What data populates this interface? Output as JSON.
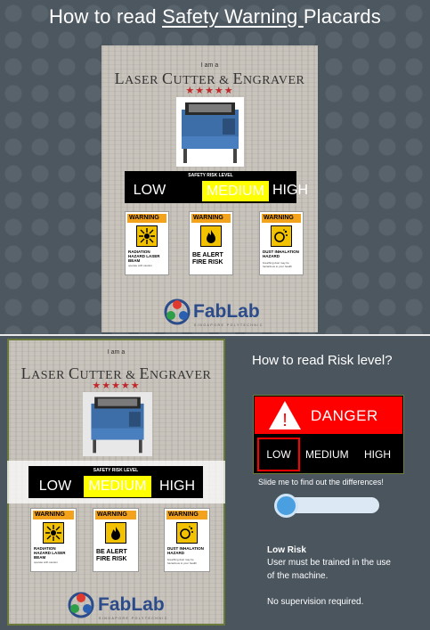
{
  "header": {
    "title_prefix": "How to read ",
    "title_underlined": "Safety Warning ",
    "title_suffix": "Placards"
  },
  "placard": {
    "intro": "I am a",
    "title_a": "L",
    "title_b": "ASER ",
    "title_c": "C",
    "title_d": "UTTER & ",
    "title_e": "E",
    "title_f": "NGRAVER",
    "stars": "★★★★★",
    "risk_caption": "SAFETY RISK LEVEL",
    "risk_low": "LOW",
    "risk_medium": "MEDIUM",
    "risk_high": "HIGH",
    "warnings": [
      {
        "head": "WARNING",
        "text": "RADIATION HAZARD LASER BEAM",
        "small": "operate with caution",
        "icon": "laser-sign"
      },
      {
        "head": "WARNING",
        "text": "BE ALERT FIRE RISK",
        "small": "",
        "icon": "fire-sign"
      },
      {
        "head": "WARNING",
        "text": "DUST INHALATION HAZARD",
        "small": "breathing dust may be hazardous to your health",
        "icon": "dust-sign"
      }
    ],
    "logo_text": "FabLab",
    "logo_sub": "SINGAPORE POLYTECHNIC"
  },
  "panel": {
    "title": "How to read Risk level?",
    "danger_mark": "!",
    "danger": "DANGER",
    "low": "LOW",
    "medium": "MEDIUM",
    "high": "HIGH",
    "hint": "Slide me to find out the differences!",
    "slider_value": 0,
    "risk_title": "Low Risk",
    "risk_desc": "User must be trained in the use of the machine.",
    "risk_note": "No supervision required."
  },
  "colors": {
    "background": "#4c5760",
    "danger_red": "#ff0000",
    "medium_yellow": "#ffff00",
    "warning_orange": "#f3a21b",
    "slider_blue": "#4a9fe0"
  }
}
